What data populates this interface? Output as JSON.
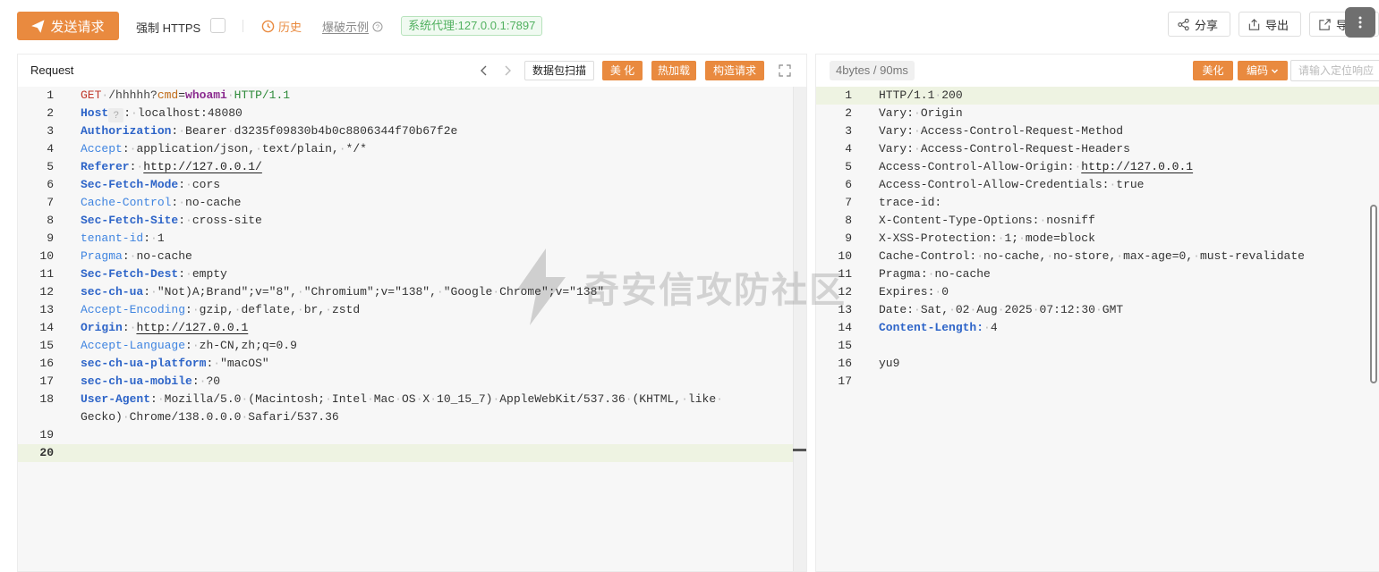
{
  "toolbar": {
    "send_label": "发送请求",
    "force_https_label": "强制 HTTPS",
    "force_https_checked": false,
    "history_label": "历史",
    "example_label": "爆破示例",
    "proxy_label": "系统代理:127.0.0.1:7897",
    "share_label": "分享",
    "export_label": "导出",
    "export2_label": "导"
  },
  "request": {
    "title": "Request",
    "buttons": {
      "scan": "数据包扫描",
      "beautify": "美 化",
      "hotload": "热加载",
      "construct": "构造请求"
    },
    "lines": [
      {
        "n": "1",
        "method": "GET",
        "path": "/hhhhh?",
        "qkey": "cmd",
        "eq": "=",
        "qval": "whoami",
        "version": "HTTP/1.1"
      },
      {
        "n": "2",
        "key": "Host",
        "badge": "?",
        "value": "localhost:48080",
        "bold": true
      },
      {
        "n": "3",
        "key": "Authorization",
        "value": "Bearer d3235f09830b4b0c8806344f70b67f2e",
        "bold": true
      },
      {
        "n": "4",
        "key": "Accept",
        "value": "application/json, text/plain, */*",
        "bold": false
      },
      {
        "n": "5",
        "key": "Referer",
        "value": "http://127.0.0.1/",
        "bold": true,
        "url": true
      },
      {
        "n": "6",
        "key": "Sec-Fetch-Mode",
        "value": "cors",
        "bold": true
      },
      {
        "n": "7",
        "key": "Cache-Control",
        "value": "no-cache",
        "bold": false
      },
      {
        "n": "8",
        "key": "Sec-Fetch-Site",
        "value": "cross-site",
        "bold": true
      },
      {
        "n": "9",
        "key": "tenant-id",
        "value": "1",
        "bold": false
      },
      {
        "n": "10",
        "key": "Pragma",
        "value": "no-cache",
        "bold": false
      },
      {
        "n": "11",
        "key": "Sec-Fetch-Dest",
        "value": "empty",
        "bold": true
      },
      {
        "n": "12",
        "key": "sec-ch-ua",
        "value": "\"Not)A;Brand\";v=\"8\", \"Chromium\";v=\"138\", \"Google Chrome\";v=\"138\"",
        "bold": true
      },
      {
        "n": "13",
        "key": "Accept-Encoding",
        "value": "gzip, deflate, br, zstd",
        "bold": false
      },
      {
        "n": "14",
        "key": "Origin",
        "value": "http://127.0.0.1",
        "bold": true,
        "url": true
      },
      {
        "n": "15",
        "key": "Accept-Language",
        "value": "zh-CN,zh;q=0.9",
        "bold": false
      },
      {
        "n": "16",
        "key": "sec-ch-ua-platform",
        "value": "\"macOS\"",
        "bold": true
      },
      {
        "n": "17",
        "key": "sec-ch-ua-mobile",
        "value": "?0",
        "bold": true
      },
      {
        "n": "18",
        "key": "User-Agent",
        "value": "Mozilla/5.0 (Macintosh; Intel Mac OS X 10_15_7) AppleWebKit/537.36 (KHTML, like",
        "cont": "Gecko) Chrome/138.0.0.0 Safari/537.36",
        "bold": true
      },
      {
        "n": "19",
        "raw": ""
      },
      {
        "n": "20",
        "raw": "",
        "active": true
      }
    ]
  },
  "response": {
    "stat": "4bytes / 90ms",
    "beautify": "美化",
    "encode": "编码",
    "search_placeholder": "请输入定位响应",
    "lines": [
      {
        "n": "1",
        "raw": "HTTP/1.1 200",
        "active": true
      },
      {
        "n": "2",
        "key": "Vary",
        "value": "Origin"
      },
      {
        "n": "3",
        "key": "Vary",
        "value": "Access-Control-Request-Method"
      },
      {
        "n": "4",
        "key": "Vary",
        "value": "Access-Control-Request-Headers"
      },
      {
        "n": "5",
        "key": "Access-Control-Allow-Origin",
        "value": "http://127.0.0.1",
        "url": true
      },
      {
        "n": "6",
        "key": "Access-Control-Allow-Credentials",
        "value": "true"
      },
      {
        "n": "7",
        "key": "trace-id",
        "value": ""
      },
      {
        "n": "8",
        "key": "X-Content-Type-Options",
        "value": "nosniff"
      },
      {
        "n": "9",
        "key": "X-XSS-Protection",
        "value": "1; mode=block"
      },
      {
        "n": "10",
        "key": "Cache-Control",
        "value": "no-cache, no-store, max-age=0, must-revalidate"
      },
      {
        "n": "11",
        "key": "Pragma",
        "value": "no-cache"
      },
      {
        "n": "12",
        "key": "Expires",
        "value": "0"
      },
      {
        "n": "13",
        "key": "Date",
        "value": "Sat, 02 Aug 2025 07:12:30 GMT"
      },
      {
        "n": "14",
        "key": "Content-Length",
        "value": "4",
        "bold": true
      },
      {
        "n": "15",
        "raw": ""
      },
      {
        "n": "16",
        "raw": "yu9"
      },
      {
        "n": "17",
        "raw": ""
      }
    ]
  },
  "watermark": "奇安信攻防社区",
  "colors": {
    "accent": "#e98a3f",
    "header_key": "#2d64c8",
    "proxy_green": "#52b160"
  },
  "icons": {
    "send": "paper-plane-icon",
    "history": "clock-icon",
    "help": "question-circle-icon",
    "share": "share-icon",
    "export": "export-icon",
    "more": "more-vertical-icon",
    "expand": "expand-icon"
  }
}
